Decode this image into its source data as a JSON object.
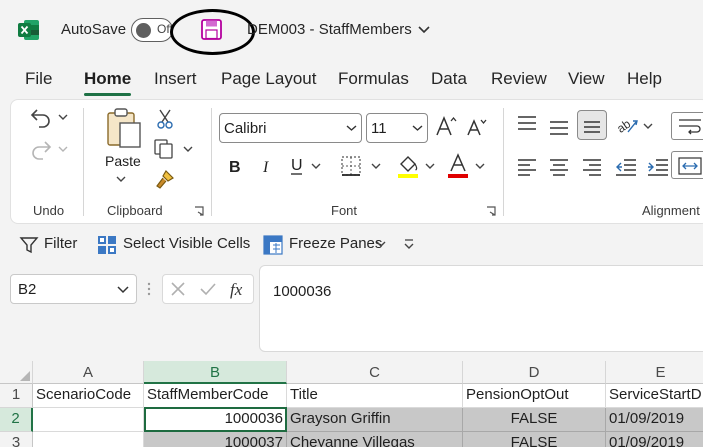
{
  "titlebar": {
    "autosave_label": "AutoSave",
    "toggle_state": "Off",
    "doc_title": "DEM003 - StaffMembers"
  },
  "tabs": [
    "File",
    "Home",
    "Insert",
    "Page Layout",
    "Formulas",
    "Data",
    "Review",
    "View",
    "Help"
  ],
  "active_tab": "Home",
  "ribbon": {
    "groups": {
      "undo": "Undo",
      "clipboard": "Clipboard",
      "font": "Font",
      "alignment": "Alignment"
    },
    "paste_label": "Paste",
    "font_name": "Calibri",
    "font_size": "11",
    "highlight_color": "#ffff00",
    "font_color": "#e00000"
  },
  "quickbar": {
    "filter": "Filter",
    "select_visible": "Select Visible Cells",
    "freeze_panes": "Freeze Panes"
  },
  "formula_bar": {
    "name_box": "B2",
    "formula": "1000036"
  },
  "sheet": {
    "column_headers": [
      "A",
      "B",
      "C",
      "D",
      "E"
    ],
    "row_numbers": [
      "1",
      "2",
      "3"
    ],
    "header_row": [
      "ScenarioCode",
      "StaffMemberCode",
      "Title",
      "PensionOptOut",
      "ServiceStartD"
    ],
    "rows": [
      [
        "",
        "1000036",
        "Grayson Griffin",
        "FALSE",
        "01/09/2019"
      ],
      [
        "",
        "1000037",
        "Cheyanne Villegas",
        "FALSE",
        "01/09/2019"
      ]
    ],
    "selected_cell": "B2"
  },
  "colors": {
    "accent": "#217346",
    "selection_fill": "#c8c8c8"
  }
}
